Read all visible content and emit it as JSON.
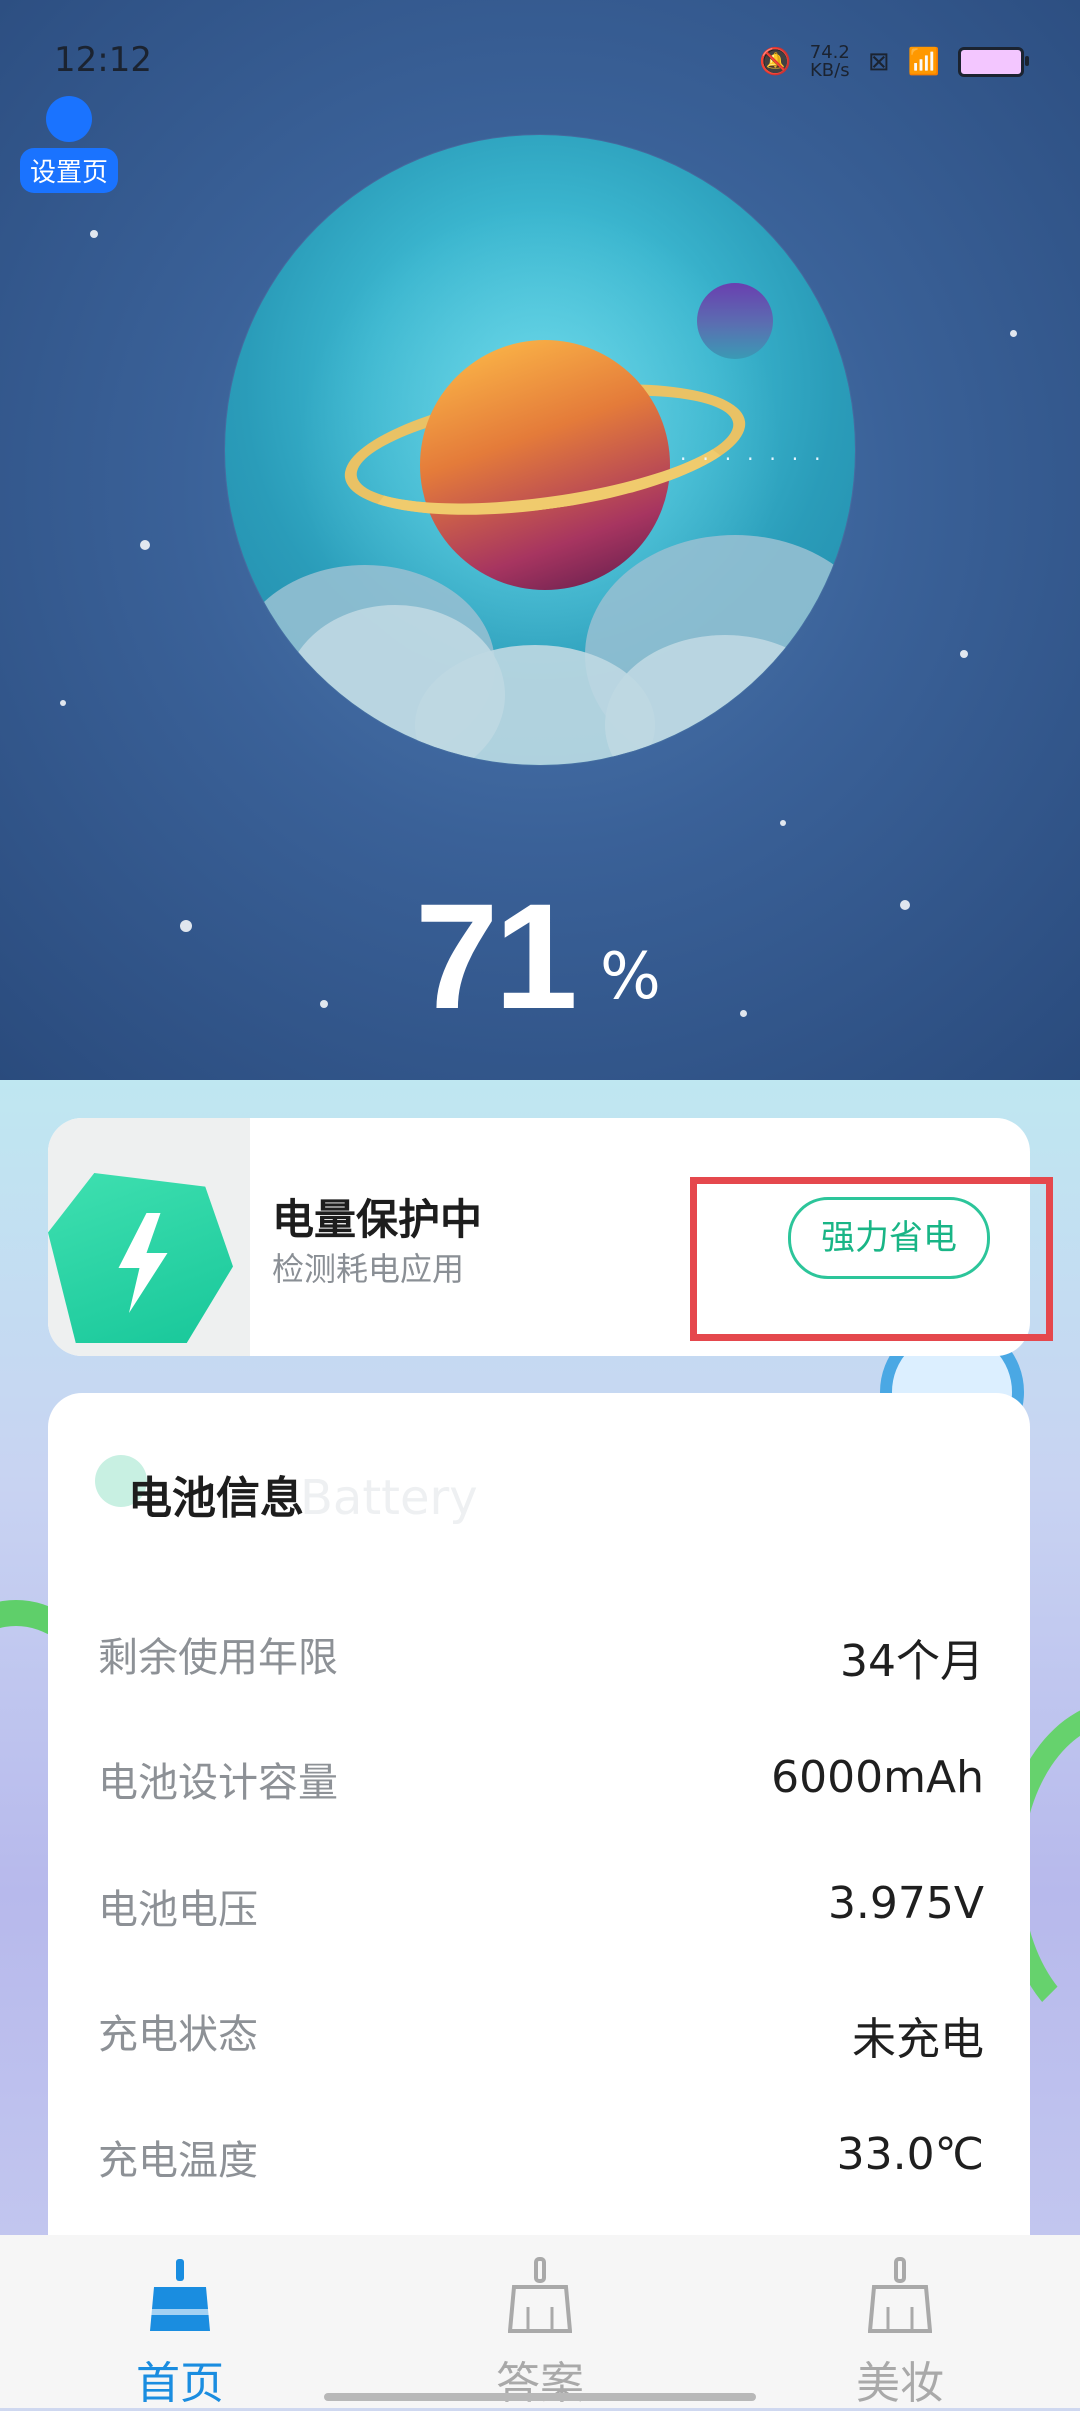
{
  "status_bar": {
    "time": "12:12",
    "net_speed_value": "74.2",
    "net_speed_unit": "KB/s"
  },
  "settings": {
    "label": "设置页"
  },
  "battery": {
    "percent": "71",
    "percent_sign": "%"
  },
  "protect_card": {
    "title": "电量保护中",
    "subtitle": "检测耗电应用",
    "button_label": "强力省电"
  },
  "info_card": {
    "title": "电池信息",
    "watermark": "Battery",
    "rows": [
      {
        "label": "剩余使用年限",
        "value": "34个月"
      },
      {
        "label": "电池设计容量",
        "value": "6000mAh"
      },
      {
        "label": "电池电压",
        "value": "3.975V"
      },
      {
        "label": "充电状态",
        "value": "未充电"
      },
      {
        "label": "充电温度",
        "value": "33.0℃"
      }
    ]
  },
  "bottom_nav": {
    "items": [
      {
        "label": "首页",
        "active": true
      },
      {
        "label": "答案",
        "active": false
      },
      {
        "label": "美妆",
        "active": false
      }
    ]
  },
  "colors": {
    "accent_green": "#19b586",
    "highlight_red": "#e5484d",
    "nav_active": "#1a8de0",
    "nav_inactive": "#a9a9a9"
  }
}
